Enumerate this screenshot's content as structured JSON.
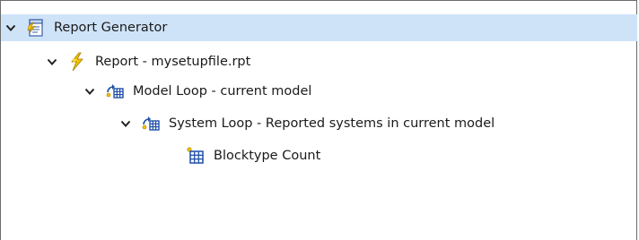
{
  "tree": {
    "nodes": [
      {
        "label": "Report Generator",
        "icon": "report-generator-icon",
        "expanded": true,
        "selected": true
      },
      {
        "label": "Report - mysetupfile.rpt",
        "icon": "report-lightning-icon",
        "expanded": true,
        "selected": false
      },
      {
        "label": "Model Loop - current model",
        "icon": "loop-grid-icon",
        "expanded": true,
        "selected": false
      },
      {
        "label": "System Loop - Reported systems in current model",
        "icon": "loop-grid-icon",
        "expanded": true,
        "selected": false
      },
      {
        "label": "Blocktype Count",
        "icon": "table-grid-icon",
        "expanded": false,
        "selected": false
      }
    ]
  },
  "colors": {
    "selection": "#cfe3f8",
    "border": "#6b6b6b",
    "lightning": "#f2c200",
    "grid_icon": "#1f4fa8"
  }
}
